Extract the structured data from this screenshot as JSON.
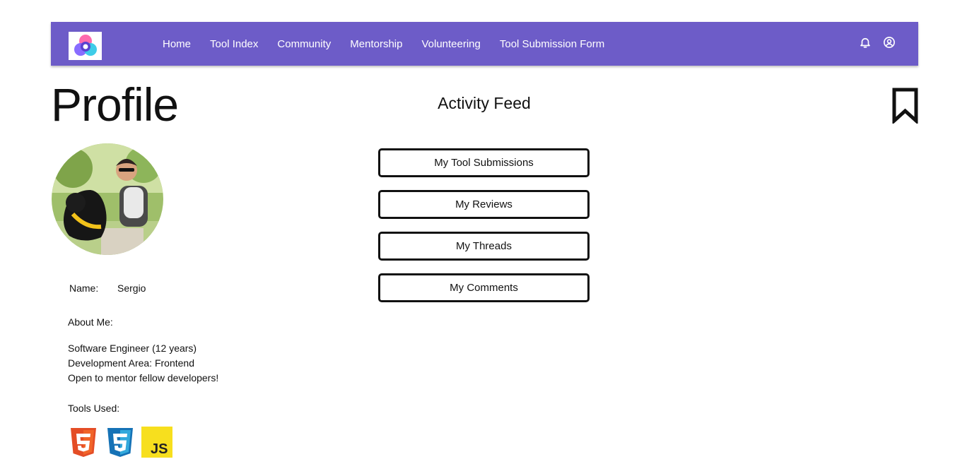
{
  "brand": {
    "logo_icon": "app-logo-icon",
    "accent": "#6d5cc8"
  },
  "nav": {
    "links": [
      {
        "label": "Home"
      },
      {
        "label": "Tool Index"
      },
      {
        "label": "Community"
      },
      {
        "label": "Mentorship"
      },
      {
        "label": "Volunteering"
      },
      {
        "label": "Tool Submission Form"
      }
    ],
    "icons": [
      "bell-icon",
      "account-circle-icon"
    ]
  },
  "page": {
    "title": "Profile",
    "bookmark_icon": "bookmark-icon"
  },
  "profile": {
    "avatar": "profile-photo",
    "name_label": "Name:",
    "name_value": "Sergio",
    "about_label": "About Me:",
    "about_lines": [
      "Software Engineer (12 years)",
      "Development Area: Frontend",
      "Open to mentor fellow developers!"
    ],
    "tools_label": "Tools Used:",
    "tools": [
      {
        "name": "HTML5",
        "icon": "html5-icon",
        "color": "#e44d26"
      },
      {
        "name": "CSS3",
        "icon": "css3-icon",
        "color": "#1572b6"
      },
      {
        "name": "JS",
        "icon": "javascript-icon",
        "color": "#f7df1e"
      }
    ]
  },
  "activity": {
    "title": "Activity Feed",
    "buttons": [
      {
        "label": "My Tool Submissions"
      },
      {
        "label": "My Reviews"
      },
      {
        "label": "My Threads"
      },
      {
        "label": "My Comments"
      }
    ]
  }
}
